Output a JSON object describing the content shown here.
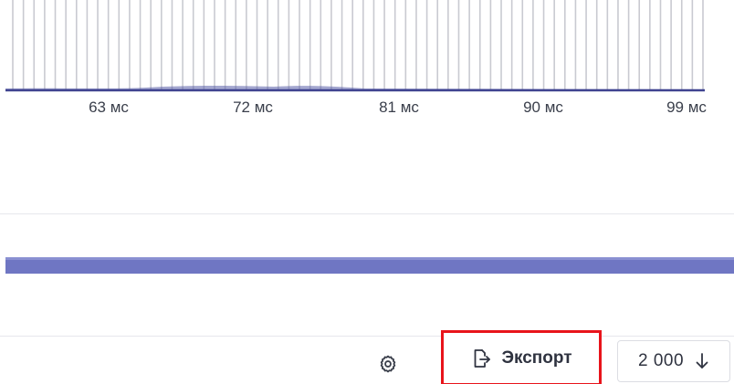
{
  "latency_chart": {
    "ticks": [
      "63 мс",
      "72 мс",
      "81 мс",
      "90 мс",
      "99 мс"
    ],
    "bar_count": 66,
    "colors": {
      "bar": "#c9cad1",
      "area": "#5a5fa8",
      "baseline": "#3f4390"
    }
  },
  "timeline": {
    "color": "#6f76c3"
  },
  "toolbar": {
    "settings_icon": "gear-icon",
    "export_icon": "export-icon",
    "export_label": "Экспорт",
    "rows_value": "2 000",
    "rows_icon": "arrow-down-icon",
    "highlight_color": "#e8141b"
  }
}
